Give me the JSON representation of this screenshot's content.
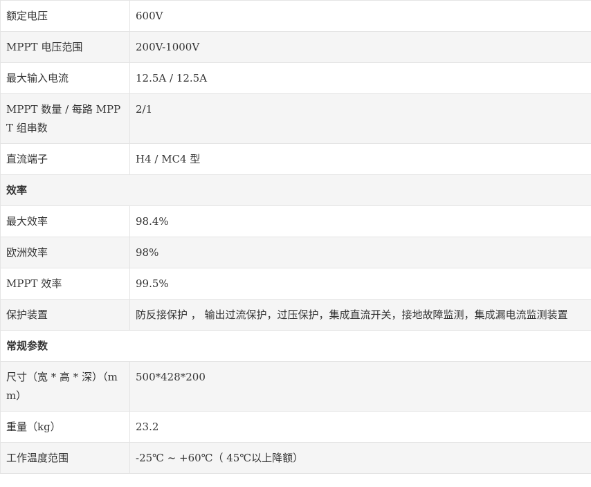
{
  "rows": [
    {
      "type": "kv",
      "key": "额定电压",
      "value": "600V"
    },
    {
      "type": "kv",
      "key": "MPPT 电压范围",
      "value": "200V-1000V"
    },
    {
      "type": "kv",
      "key": "最大输入电流",
      "value": "12.5A / 12.5A"
    },
    {
      "type": "kv",
      "key": "MPPT 数量 / 每路 MPPT 组串数",
      "value": "2/1"
    },
    {
      "type": "kv",
      "key": "直流端子",
      "value": "H4 / MC4 型"
    },
    {
      "type": "section",
      "title": "效率"
    },
    {
      "type": "kv",
      "key": "最大效率",
      "value": "98.4%"
    },
    {
      "type": "kv",
      "key": "欧洲效率",
      "value": "98%"
    },
    {
      "type": "kv",
      "key": "MPPT 效率",
      "value": "99.5%"
    },
    {
      "type": "kv",
      "key": "保护装置",
      "value": "防反接保护 ， 输出过流保护，过压保护，集成直流开关，接地故障监测，集成漏电流监测装置"
    },
    {
      "type": "section",
      "title": "常规参数"
    },
    {
      "type": "kv",
      "key": "尺寸（宽 * 高 * 深）（mm）",
      "value": "500*428*200"
    },
    {
      "type": "kv",
      "key": "重量（kg）",
      "value": "23.2"
    },
    {
      "type": "kv",
      "key": "工作温度范围",
      "value": "-25℃ ~ +60℃（ 45℃以上降额）"
    }
  ]
}
